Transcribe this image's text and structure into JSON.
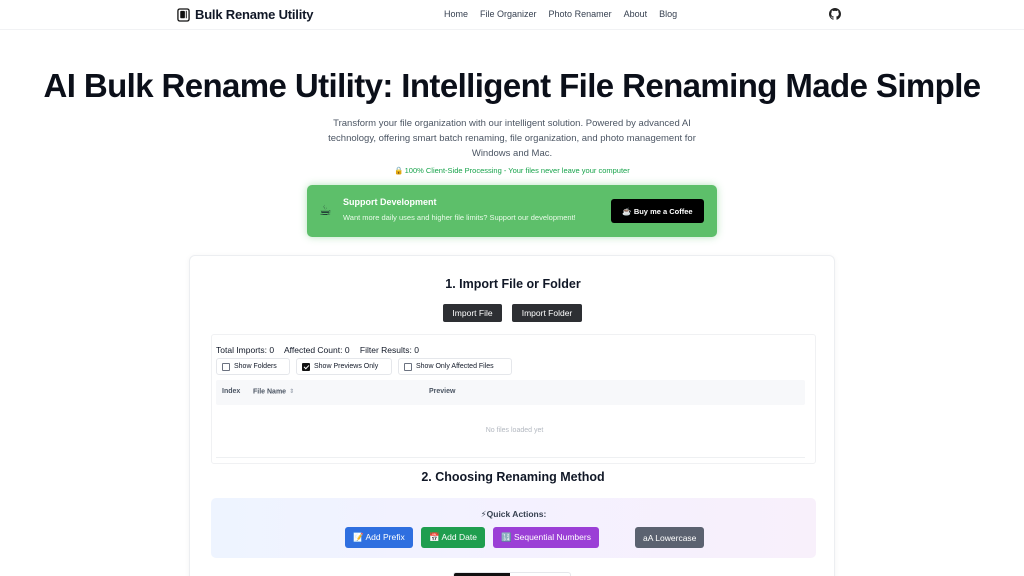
{
  "brand": {
    "name": "Bulk Rename Utility",
    "icon": "document-stack-icon"
  },
  "nav": {
    "links": [
      "Home",
      "File Organizer",
      "Photo Renamer",
      "About",
      "Blog"
    ],
    "github_icon": "github-icon"
  },
  "hero": {
    "title": "AI Bulk Rename Utility: Intelligent File Renaming Made Simple",
    "subtitle": "Transform your file organization with our intelligent solution. Powered by advanced AI technology, offering smart batch renaming, file organization, and photo management for Windows and Mac.",
    "privacy_icon": "🔒",
    "privacy": "100% Client-Side Processing - Your files never leave your computer"
  },
  "support": {
    "icon": "☕",
    "title": "Support Development",
    "text": "Want more daily uses and higher file limits? Support our development!",
    "button": "☕ Buy me a Coffee"
  },
  "import_section": {
    "title": "1. Import File or Folder",
    "import_file": "Import File",
    "import_folder": "Import Folder",
    "stats": {
      "total_imports": "Total Imports: 0",
      "affected_count": "Affected Count: 0",
      "filter_results": "Filter Results: 0"
    },
    "filters": [
      {
        "label": "Show Folders",
        "checked": false
      },
      {
        "label": "Show Previews Only",
        "checked": true
      },
      {
        "label": "Show Only Affected Files",
        "checked": false
      }
    ],
    "columns": {
      "index": "Index",
      "file_name": "File Name",
      "preview": "Preview"
    },
    "empty_text": "No files loaded yet"
  },
  "rename_section": {
    "title": "2. Choosing Renaming Method",
    "quick_icon": "⚡",
    "quick_title": "Quick Actions:",
    "actions": [
      {
        "label": "📝 Add Prefix",
        "color": "#2f6fe0"
      },
      {
        "label": "📅 Add Date",
        "color": "#1f9e4f"
      },
      {
        "label": "🔢 Sequential Numbers",
        "color": "#9b3fd6"
      },
      {
        "label": "aA  Lowercase",
        "color": "#5b6270"
      }
    ]
  }
}
